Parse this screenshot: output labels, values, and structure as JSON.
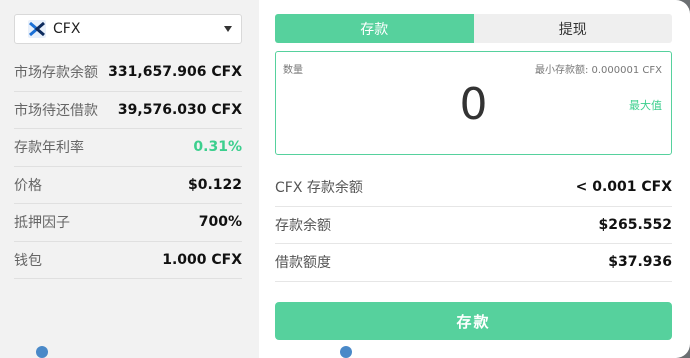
{
  "token_select": {
    "selected": "CFX",
    "logo_icon": "cfx-logo-icon"
  },
  "market_stats": [
    {
      "label": "市场存款余额",
      "value": "331,657.906 CFX",
      "color": "#111111"
    },
    {
      "label": "市场待还借款",
      "value": "39,576.030 CFX",
      "color": "#111111"
    },
    {
      "label": "存款年利率",
      "value": "0.31%",
      "color": "#3ccf8e"
    },
    {
      "label": "价格",
      "value": "$0.122",
      "color": "#111111"
    },
    {
      "label": "抵押因子",
      "value": "700%",
      "color": "#111111"
    },
    {
      "label": "钱包",
      "value": "1.000 CFX",
      "color": "#111111"
    }
  ],
  "tabs": {
    "deposit": "存款",
    "withdraw": "提现"
  },
  "amount": {
    "label": "数量",
    "min_deposit": "最小存款额: 0.000001 CFX",
    "value": "0",
    "max_label": "最大值"
  },
  "deposit_info": [
    {
      "label": "CFX 存款余额",
      "value": "< 0.001 CFX"
    },
    {
      "label": "存款余额",
      "value": "$265.552"
    },
    {
      "label": "借款额度",
      "value": "$37.936"
    }
  ],
  "submit_label": "存款",
  "colors": {
    "accent": "#56d19d",
    "positive": "#3ccf8e"
  }
}
